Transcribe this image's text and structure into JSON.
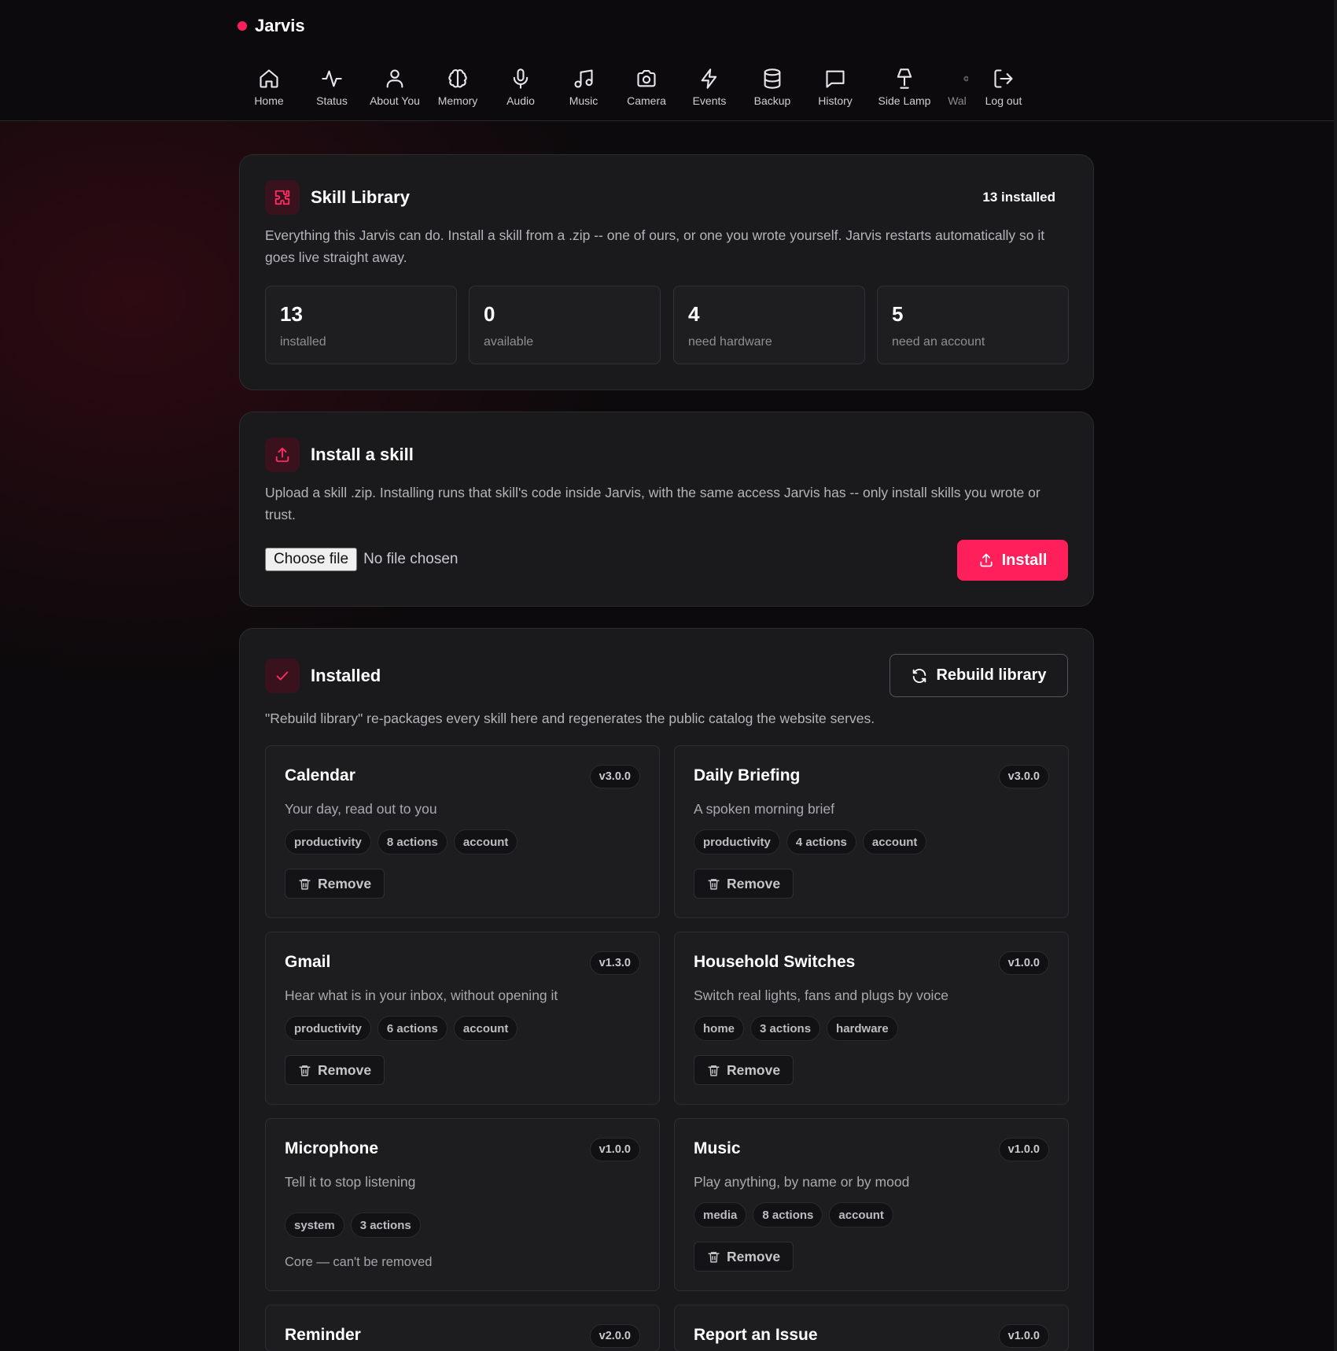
{
  "app": {
    "name": "Jarvis",
    "accent_color": "#ff1f5a"
  },
  "nav": [
    {
      "label": "Home",
      "icon": "home-icon"
    },
    {
      "label": "Status",
      "icon": "activity-icon"
    },
    {
      "label": "About You",
      "icon": "user-icon"
    },
    {
      "label": "Memory",
      "icon": "brain-icon"
    },
    {
      "label": "Audio",
      "icon": "microphone-icon"
    },
    {
      "label": "Music",
      "icon": "music-note-icon"
    },
    {
      "label": "Camera",
      "icon": "camera-icon"
    },
    {
      "label": "Events",
      "icon": "lightning-icon"
    },
    {
      "label": "Backup",
      "icon": "database-icon"
    },
    {
      "label": "History",
      "icon": "chat-bubble-icon"
    },
    {
      "label": "Side Lamp",
      "icon": "lamp-icon"
    },
    {
      "label": "Wal",
      "icon": "partial-icon"
    },
    {
      "label": "Log out",
      "icon": "logout-icon"
    }
  ],
  "library": {
    "title": "Skill Library",
    "count_label": "13 installed",
    "description": "Everything this Jarvis can do. Install a skill from a .zip -- one of ours, or one you wrote yourself. Jarvis restarts automatically so it goes live straight away.",
    "stats": [
      {
        "value": "13",
        "label": "installed"
      },
      {
        "value": "0",
        "label": "available"
      },
      {
        "value": "4",
        "label": "need hardware"
      },
      {
        "value": "5",
        "label": "need an account"
      }
    ]
  },
  "install": {
    "title": "Install a skill",
    "description": "Upload a skill .zip. Installing runs that skill's code inside Jarvis, with the same access Jarvis has -- only install skills you wrote or trust.",
    "choose_label": "Choose file",
    "file_status": "No file chosen",
    "button_label": "Install"
  },
  "installed": {
    "title": "Installed",
    "rebuild_label": "Rebuild library",
    "description": "\"Rebuild library\" re-packages every skill here and regenerates the public catalog the website serves.",
    "remove_label": "Remove",
    "core_note": "Core — can't be removed",
    "skills": [
      {
        "name": "Calendar",
        "version": "v3.0.0",
        "description": "Your day, read out to you",
        "tags": [
          "productivity",
          "8 actions",
          "account"
        ]
      },
      {
        "name": "Daily Briefing",
        "version": "v3.0.0",
        "description": "A spoken morning brief",
        "tags": [
          "productivity",
          "4 actions",
          "account"
        ]
      },
      {
        "name": "Gmail",
        "version": "v1.3.0",
        "description": "Hear what is in your inbox, without opening it",
        "tags": [
          "productivity",
          "6 actions",
          "account"
        ]
      },
      {
        "name": "Household Switches",
        "version": "v1.0.0",
        "description": "Switch real lights, fans and plugs by voice",
        "tags": [
          "home",
          "3 actions",
          "hardware"
        ]
      },
      {
        "name": "Microphone",
        "version": "v1.0.0",
        "description": "Tell it to stop listening",
        "tags": [
          "system",
          "3 actions"
        ]
      },
      {
        "name": "Music",
        "version": "v1.0.0",
        "description": "Play anything, by name or by mood",
        "tags": [
          "media",
          "8 actions",
          "account"
        ]
      },
      {
        "name": "Reminder",
        "version": "v2.0.0"
      },
      {
        "name": "Report an Issue",
        "version": "v1.0.0"
      }
    ]
  }
}
